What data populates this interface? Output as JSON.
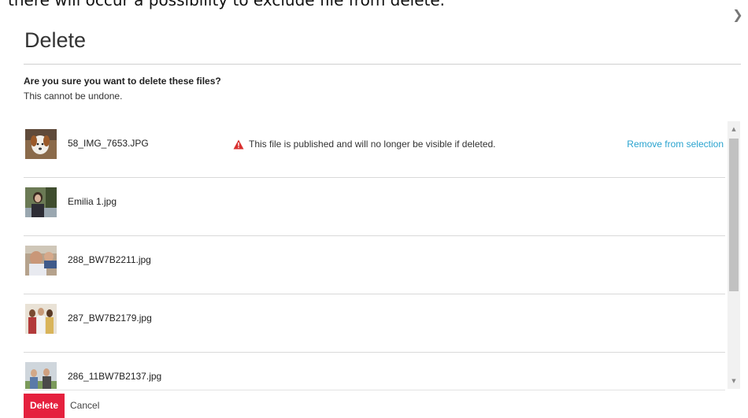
{
  "cutoff_text": "there will occur a possibility to exclude file from delete.",
  "dialog": {
    "title": "Delete",
    "question": "Are you sure you want to delete these files?",
    "subtitle": "This cannot be undone."
  },
  "files": [
    {
      "name": "58_IMG_7653.JPG",
      "warning": "This file is published and will no longer be visible if deleted.",
      "action": "Remove from selection"
    },
    {
      "name": "Emilia 1.jpg"
    },
    {
      "name": "288_BW7B2211.jpg"
    },
    {
      "name": "287_BW7B2179.jpg"
    },
    {
      "name": "286_11BW7B2137.jpg"
    }
  ],
  "buttons": {
    "delete": "Delete",
    "cancel": "Cancel"
  },
  "colors": {
    "accent_red": "#e5213e",
    "link_blue": "#29a3cf",
    "warning_red": "#d9302f"
  },
  "icons": {
    "close": "close-icon",
    "warning": "warning-triangle-icon",
    "scroll_up": "scroll-up-icon",
    "scroll_down": "scroll-down-icon"
  }
}
